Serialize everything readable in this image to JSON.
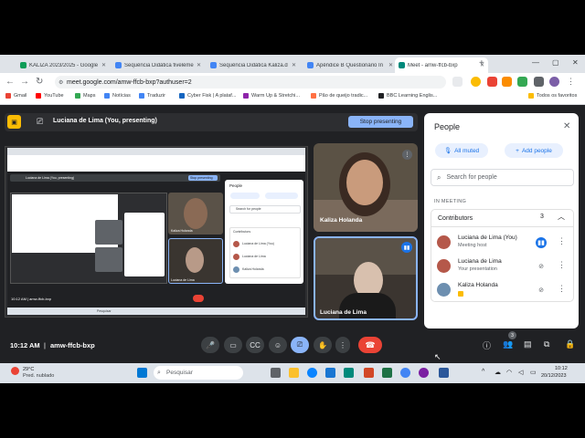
{
  "browser": {
    "tabs": [
      {
        "label": "KALIZA 2023/2025 - Google",
        "color": "#0f9d58",
        "active": false
      },
      {
        "label": "Sequência Didática fiveléme",
        "color": "#4285f4",
        "active": false
      },
      {
        "label": "Sequência Didática Kaliza.d",
        "color": "#4285f4",
        "active": false
      },
      {
        "label": "Apêndice B Questionário In",
        "color": "#4285f4",
        "active": false
      },
      {
        "label": "Meet - amw-ffcb-bxp",
        "color": "#00897b",
        "active": true
      }
    ],
    "url": "meet.google.com/amw-ffcb-bxp?authuser=2",
    "bookmarks": [
      {
        "label": "Gmail",
        "color": "#ea4335"
      },
      {
        "label": "YouTube",
        "color": "#ff0000"
      },
      {
        "label": "Maps",
        "color": "#34a853"
      },
      {
        "label": "Notícias",
        "color": "#4285f4"
      },
      {
        "label": "Traduzir",
        "color": "#4285f4"
      },
      {
        "label": "Cyber Fisk | A plataf...",
        "color": "#1565c0"
      },
      {
        "label": "Warm Up & Stretchi...",
        "color": "#8e24aa"
      },
      {
        "label": "Pão de queijo tradic...",
        "color": "#ff7043"
      },
      {
        "label": "BBC Learning Englis...",
        "color": "#202124"
      }
    ],
    "all_bookmarks": "Todos os favoritos"
  },
  "meet": {
    "presenting_title": "Luciana de Lima (You, presenting)",
    "stop_presenting": "Stop presenting",
    "tiles": [
      {
        "name": "Kaliza Holanda"
      },
      {
        "name": "Luciana de Lima"
      }
    ],
    "time": "10:12 AM",
    "separator": "|",
    "meeting_code": "amw-ffcb-bxp",
    "participant_badge": "3"
  },
  "panel": {
    "title": "People",
    "all_muted": "All muted",
    "add_people": "Add people",
    "search_placeholder": "Search for people",
    "section": "IN MEETING",
    "group_label": "Contributors",
    "group_count": "3",
    "participants": [
      {
        "name": "Luciana de Lima (You)",
        "subtitle": "Meeting host",
        "avatar": "#b5584a",
        "mic": "active"
      },
      {
        "name": "Luciana de Lima",
        "subtitle": "Your presentation",
        "avatar": "#b5584a",
        "mic": "muted"
      },
      {
        "name": "Kaliza Holanda",
        "subtitle": "",
        "avatar": "#6d8fb0",
        "mic": "muted"
      }
    ]
  },
  "taskbar": {
    "temp": "29°C",
    "weather": "Pred. nublado",
    "search": "Pesquisar",
    "clock_time": "10:12",
    "clock_date": "20/12/2023"
  },
  "mini": {
    "title": "Luciana de Lima (You, presenting)",
    "stop": "Stop presenting",
    "people": "People",
    "search": "Search for people",
    "contributors": "Contributors",
    "tile1": "Kaliza Holanda",
    "tile2": "Luciana de Lima",
    "p1": "Luciana de Lima (You)",
    "p2": "Luciana de Lima",
    "p3": "Kaliza Holanda",
    "code": "10:12 AM | amw-ffcb-bxp",
    "search_tb": "Pesquisar"
  }
}
